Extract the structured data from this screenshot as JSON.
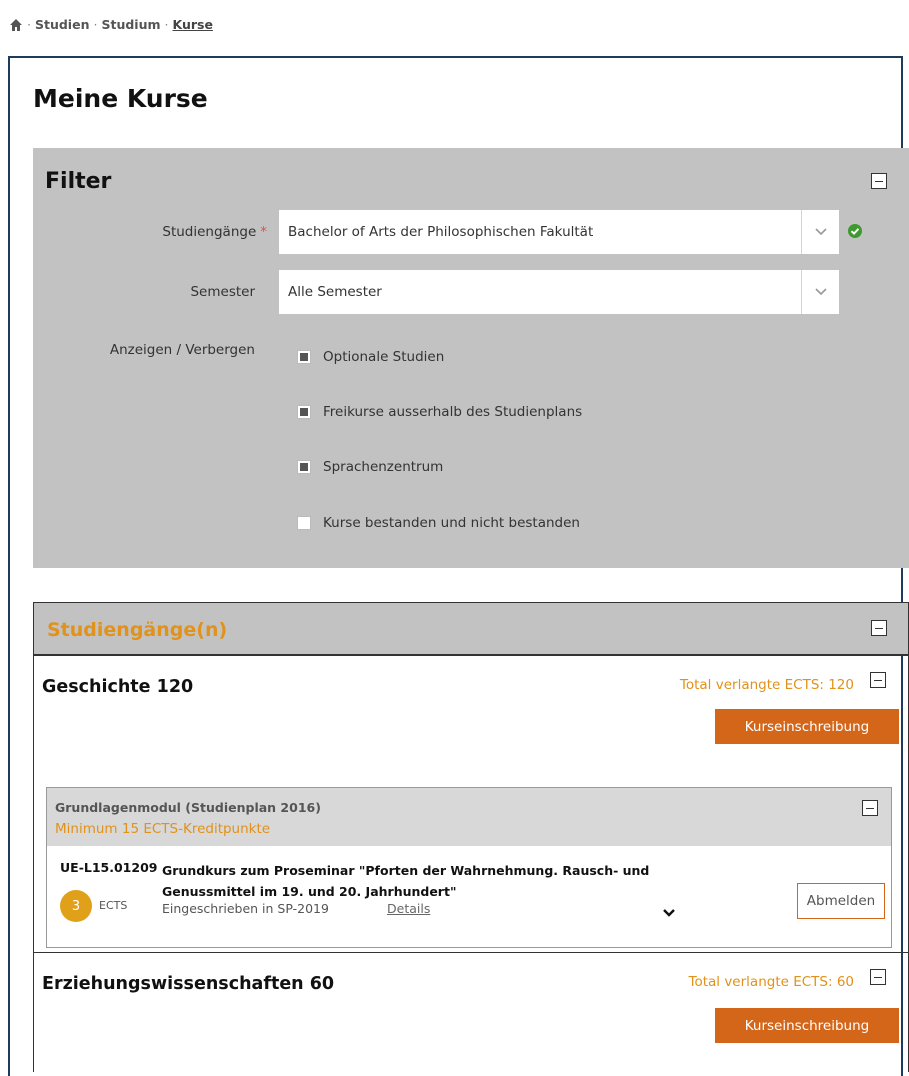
{
  "breadcrumb": {
    "items": [
      "Studien",
      "Studium"
    ],
    "current": "Kurse",
    "separator": "·"
  },
  "page_title": "Meine Kurse",
  "filter": {
    "title": "Filter",
    "studiengaenge_label": "Studiengänge",
    "studiengaenge_required": "*",
    "studiengaenge_value": "Bachelor of Arts der Philosophischen Fakultät",
    "semester_label": "Semester",
    "semester_value": "Alle Semester",
    "show_hide_label": "Anzeigen / Verbergen",
    "checkboxes": [
      {
        "label": "Optionale Studien",
        "checked": true
      },
      {
        "label": "Freikurse ausserhalb des Studienplans",
        "checked": true
      },
      {
        "label": "Sprachenzentrum",
        "checked": true
      },
      {
        "label": "Kurse bestanden und nicht bestanden",
        "checked": false
      }
    ]
  },
  "studiengaenge": {
    "title": "Studiengänge(n)",
    "programs": [
      {
        "name": "Geschichte 120",
        "ects_total": "Total verlangte ECTS: 120",
        "enroll_label": "Kurseinschreibung",
        "module": {
          "title": "Grundlagenmodul (Studienplan 2016)",
          "minimum": "Minimum 15 ECTS-Kreditpunkte",
          "course": {
            "code": "UE-L15.01209",
            "title": "Grundkurs zum Proseminar \"Pforten der Wahrnehmung. Rausch- und Genussmittel im 19. und 20. Jahrhundert\"",
            "ects": "3",
            "ects_label": "ECTS",
            "enrolled": "Eingeschrieben in SP-2019",
            "details": "Details",
            "unsubscribe": "Abmelden"
          }
        }
      },
      {
        "name": "Erziehungswissenschaften 60",
        "ects_total": "Total verlangte ECTS: 60",
        "enroll_label": "Kurseinschreibung"
      }
    ]
  },
  "colors": {
    "accent_orange": "#e0921a",
    "button_orange": "#d4661a",
    "panel_gray": "#c2c2c2",
    "frame_navy": "#1f3a5f",
    "ok_green": "#3c9a2e"
  }
}
